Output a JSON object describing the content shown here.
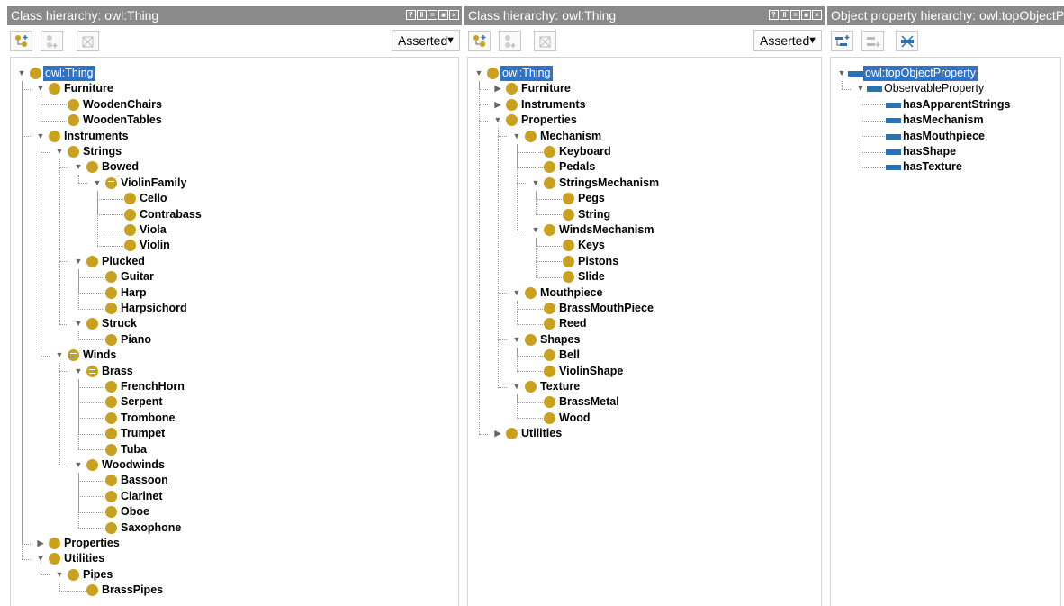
{
  "panels": [
    {
      "title": "Class hierarchy: owl:Thing",
      "mode": "Asserted",
      "rows": [
        {
          "label": "owl:Thing",
          "depth": 0,
          "toggle": "open",
          "selected": true
        },
        {
          "label": "Furniture",
          "depth": 1,
          "toggle": "open"
        },
        {
          "label": "WoodenChairs",
          "depth": 2,
          "toggle": "none"
        },
        {
          "label": "WoodenTables",
          "depth": 2,
          "toggle": "none"
        },
        {
          "label": "Instruments",
          "depth": 1,
          "toggle": "open"
        },
        {
          "label": "Strings",
          "depth": 2,
          "toggle": "open"
        },
        {
          "label": "Bowed",
          "depth": 3,
          "toggle": "open"
        },
        {
          "label": "ViolinFamily",
          "depth": 4,
          "toggle": "open",
          "equiv": true
        },
        {
          "label": "Cello",
          "depth": 5,
          "toggle": "none"
        },
        {
          "label": "Contrabass",
          "depth": 5,
          "toggle": "none"
        },
        {
          "label": "Viola",
          "depth": 5,
          "toggle": "none"
        },
        {
          "label": "Violin",
          "depth": 5,
          "toggle": "none"
        },
        {
          "label": "Plucked",
          "depth": 3,
          "toggle": "open"
        },
        {
          "label": "Guitar",
          "depth": 4,
          "toggle": "none"
        },
        {
          "label": "Harp",
          "depth": 4,
          "toggle": "none"
        },
        {
          "label": "Harpsichord",
          "depth": 4,
          "toggle": "none"
        },
        {
          "label": "Struck",
          "depth": 3,
          "toggle": "open"
        },
        {
          "label": "Piano",
          "depth": 4,
          "toggle": "none"
        },
        {
          "label": "Winds",
          "depth": 2,
          "toggle": "open",
          "equiv": true
        },
        {
          "label": "Brass",
          "depth": 3,
          "toggle": "open",
          "equiv": true
        },
        {
          "label": "FrenchHorn",
          "depth": 4,
          "toggle": "none"
        },
        {
          "label": "Serpent",
          "depth": 4,
          "toggle": "none"
        },
        {
          "label": "Trombone",
          "depth": 4,
          "toggle": "none"
        },
        {
          "label": "Trumpet",
          "depth": 4,
          "toggle": "none"
        },
        {
          "label": "Tuba",
          "depth": 4,
          "toggle": "none"
        },
        {
          "label": "Woodwinds",
          "depth": 3,
          "toggle": "open"
        },
        {
          "label": "Bassoon",
          "depth": 4,
          "toggle": "none"
        },
        {
          "label": "Clarinet",
          "depth": 4,
          "toggle": "none"
        },
        {
          "label": "Oboe",
          "depth": 4,
          "toggle": "none"
        },
        {
          "label": "Saxophone",
          "depth": 4,
          "toggle": "none"
        },
        {
          "label": "Properties",
          "depth": 1,
          "toggle": "closed"
        },
        {
          "label": "Utilities",
          "depth": 1,
          "toggle": "open"
        },
        {
          "label": "Pipes",
          "depth": 2,
          "toggle": "open"
        },
        {
          "label": "BrassPipes",
          "depth": 3,
          "toggle": "none"
        }
      ]
    },
    {
      "title": "Class hierarchy: owl:Thing",
      "mode": "Asserted",
      "rows": [
        {
          "label": "owl:Thing",
          "depth": 0,
          "toggle": "open",
          "selected": true
        },
        {
          "label": "Furniture",
          "depth": 1,
          "toggle": "closed"
        },
        {
          "label": "Instruments",
          "depth": 1,
          "toggle": "closed"
        },
        {
          "label": "Properties",
          "depth": 1,
          "toggle": "open"
        },
        {
          "label": "Mechanism",
          "depth": 2,
          "toggle": "open"
        },
        {
          "label": "Keyboard",
          "depth": 3,
          "toggle": "none"
        },
        {
          "label": "Pedals",
          "depth": 3,
          "toggle": "none"
        },
        {
          "label": "StringsMechanism",
          "depth": 3,
          "toggle": "open"
        },
        {
          "label": "Pegs",
          "depth": 4,
          "toggle": "none"
        },
        {
          "label": "String",
          "depth": 4,
          "toggle": "none"
        },
        {
          "label": "WindsMechanism",
          "depth": 3,
          "toggle": "open"
        },
        {
          "label": "Keys",
          "depth": 4,
          "toggle": "none"
        },
        {
          "label": "Pistons",
          "depth": 4,
          "toggle": "none"
        },
        {
          "label": "Slide",
          "depth": 4,
          "toggle": "none"
        },
        {
          "label": "Mouthpiece",
          "depth": 2,
          "toggle": "open"
        },
        {
          "label": "BrassMouthPiece",
          "depth": 3,
          "toggle": "none"
        },
        {
          "label": "Reed",
          "depth": 3,
          "toggle": "none"
        },
        {
          "label": "Shapes",
          "depth": 2,
          "toggle": "open"
        },
        {
          "label": "Bell",
          "depth": 3,
          "toggle": "none"
        },
        {
          "label": "ViolinShape",
          "depth": 3,
          "toggle": "none"
        },
        {
          "label": "Texture",
          "depth": 2,
          "toggle": "open"
        },
        {
          "label": "BrassMetal",
          "depth": 3,
          "toggle": "none"
        },
        {
          "label": "Wood",
          "depth": 3,
          "toggle": "none"
        },
        {
          "label": "Utilities",
          "depth": 1,
          "toggle": "closed"
        }
      ]
    },
    {
      "title": "Object property hierarchy: owl:topObjectProperty",
      "rows": [
        {
          "label": "owl:topObjectProperty",
          "depth": 0,
          "toggle": "open",
          "selected": true,
          "kind": "property"
        },
        {
          "label": "ObservableProperty",
          "depth": 1,
          "toggle": "open",
          "kind": "property",
          "plain": true
        },
        {
          "label": "hasApparentStrings",
          "depth": 2,
          "toggle": "none",
          "kind": "property"
        },
        {
          "label": "hasMechanism",
          "depth": 2,
          "toggle": "none",
          "kind": "property"
        },
        {
          "label": "hasMouthpiece",
          "depth": 2,
          "toggle": "none",
          "kind": "property"
        },
        {
          "label": "hasShape",
          "depth": 2,
          "toggle": "none",
          "kind": "property"
        },
        {
          "label": "hasTexture",
          "depth": 2,
          "toggle": "none",
          "kind": "property"
        }
      ]
    }
  ]
}
